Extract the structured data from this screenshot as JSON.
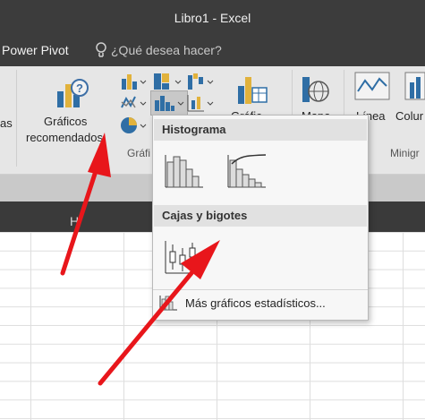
{
  "window": {
    "title": "Libro1 - Excel"
  },
  "tabs": {
    "power_pivot": "Power Pivot",
    "tell_me": "¿Qué desea hacer?"
  },
  "ribbon": {
    "left_partial": "as",
    "recommended_line1": "Gráficos",
    "recommended_line2": "recomendados",
    "group_partial": "Gráfi",
    "pivot_partial": "Gráfic",
    "maps_partial": "Mapa",
    "line": "Línea",
    "column_partial": "Colur",
    "sparklines_partial": "Minigr"
  },
  "sheet": {
    "column_h": "H"
  },
  "dropdown": {
    "histogram_header": "Histograma",
    "boxwhisker_header": "Cajas y bigotes",
    "more_charts": "Más gráficos estadísticos..."
  },
  "colors": {
    "arrow": "#e8161b",
    "titlebar": "#3c3c3c",
    "ribbon": "#e6e6e6"
  }
}
